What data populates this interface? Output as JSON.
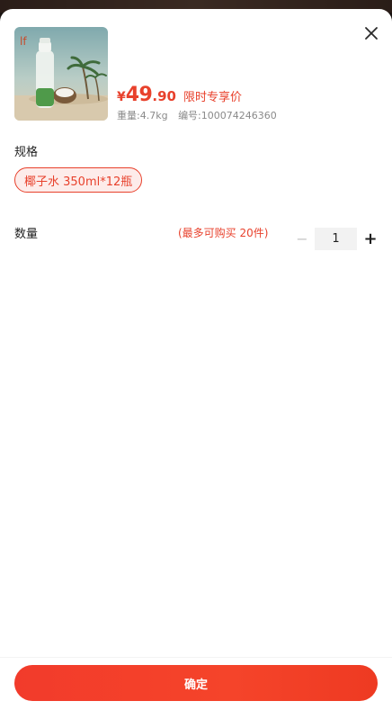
{
  "product": {
    "image_icon": "coconut-water-bottle-beach-photo",
    "price_symbol": "¥",
    "price_int": "49",
    "price_dec": ".90",
    "price_tag": "限时专享价",
    "weight": "重量:4.7kg",
    "sku": "编号:100074246360"
  },
  "spec": {
    "title": "规格",
    "options": [
      "椰子水 350ml*12瓶"
    ],
    "selected": "椰子水 350ml*12瓶"
  },
  "quantity": {
    "title": "数量",
    "limit": "(最多可购买 20件)",
    "minus": "−",
    "value": "1",
    "plus": "+"
  },
  "footer": {
    "confirm_label": "确定"
  },
  "colors": {
    "accent": "#e8412c",
    "chip_bg": "#fdecea",
    "muted": "#8a8a8a"
  },
  "icons": {
    "close": "close-icon"
  }
}
